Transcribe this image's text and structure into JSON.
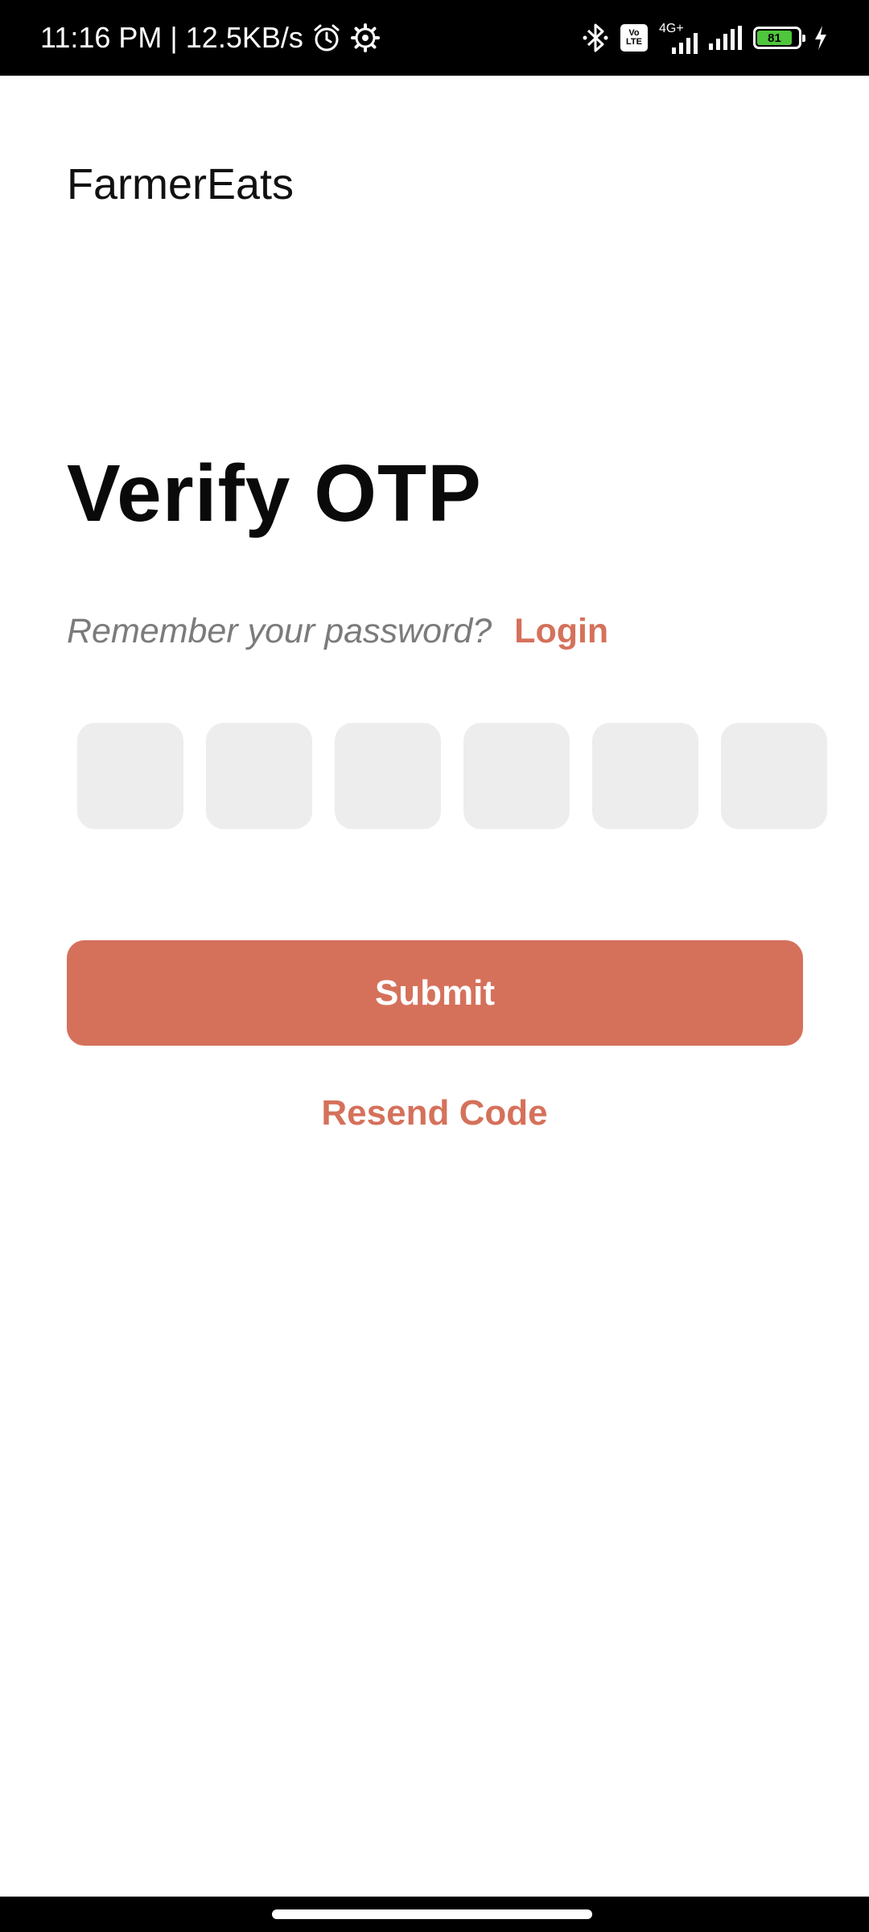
{
  "status_bar": {
    "time_speed": "11:16 PM | 12.5KB/s",
    "network_label": "4G+",
    "volte_top": "Vo",
    "volte_bottom": "LTE",
    "battery": "81",
    "icons": [
      "alarm-icon",
      "settings-icon",
      "bluetooth-icon",
      "volte-icon",
      "signal-icon",
      "battery-icon",
      "charging-icon"
    ]
  },
  "app": {
    "brand": "FarmerEats"
  },
  "main": {
    "title": "Verify OTP",
    "remember_text": "Remember your password?",
    "login_label": "Login",
    "otp_digits": [
      "",
      "",
      "",
      "",
      "",
      ""
    ],
    "submit_label": "Submit",
    "resend_label": "Resend Code"
  },
  "colors": {
    "accent": "#d5715b",
    "otp_box": "#ededed",
    "muted_text": "#7b7b7b"
  }
}
